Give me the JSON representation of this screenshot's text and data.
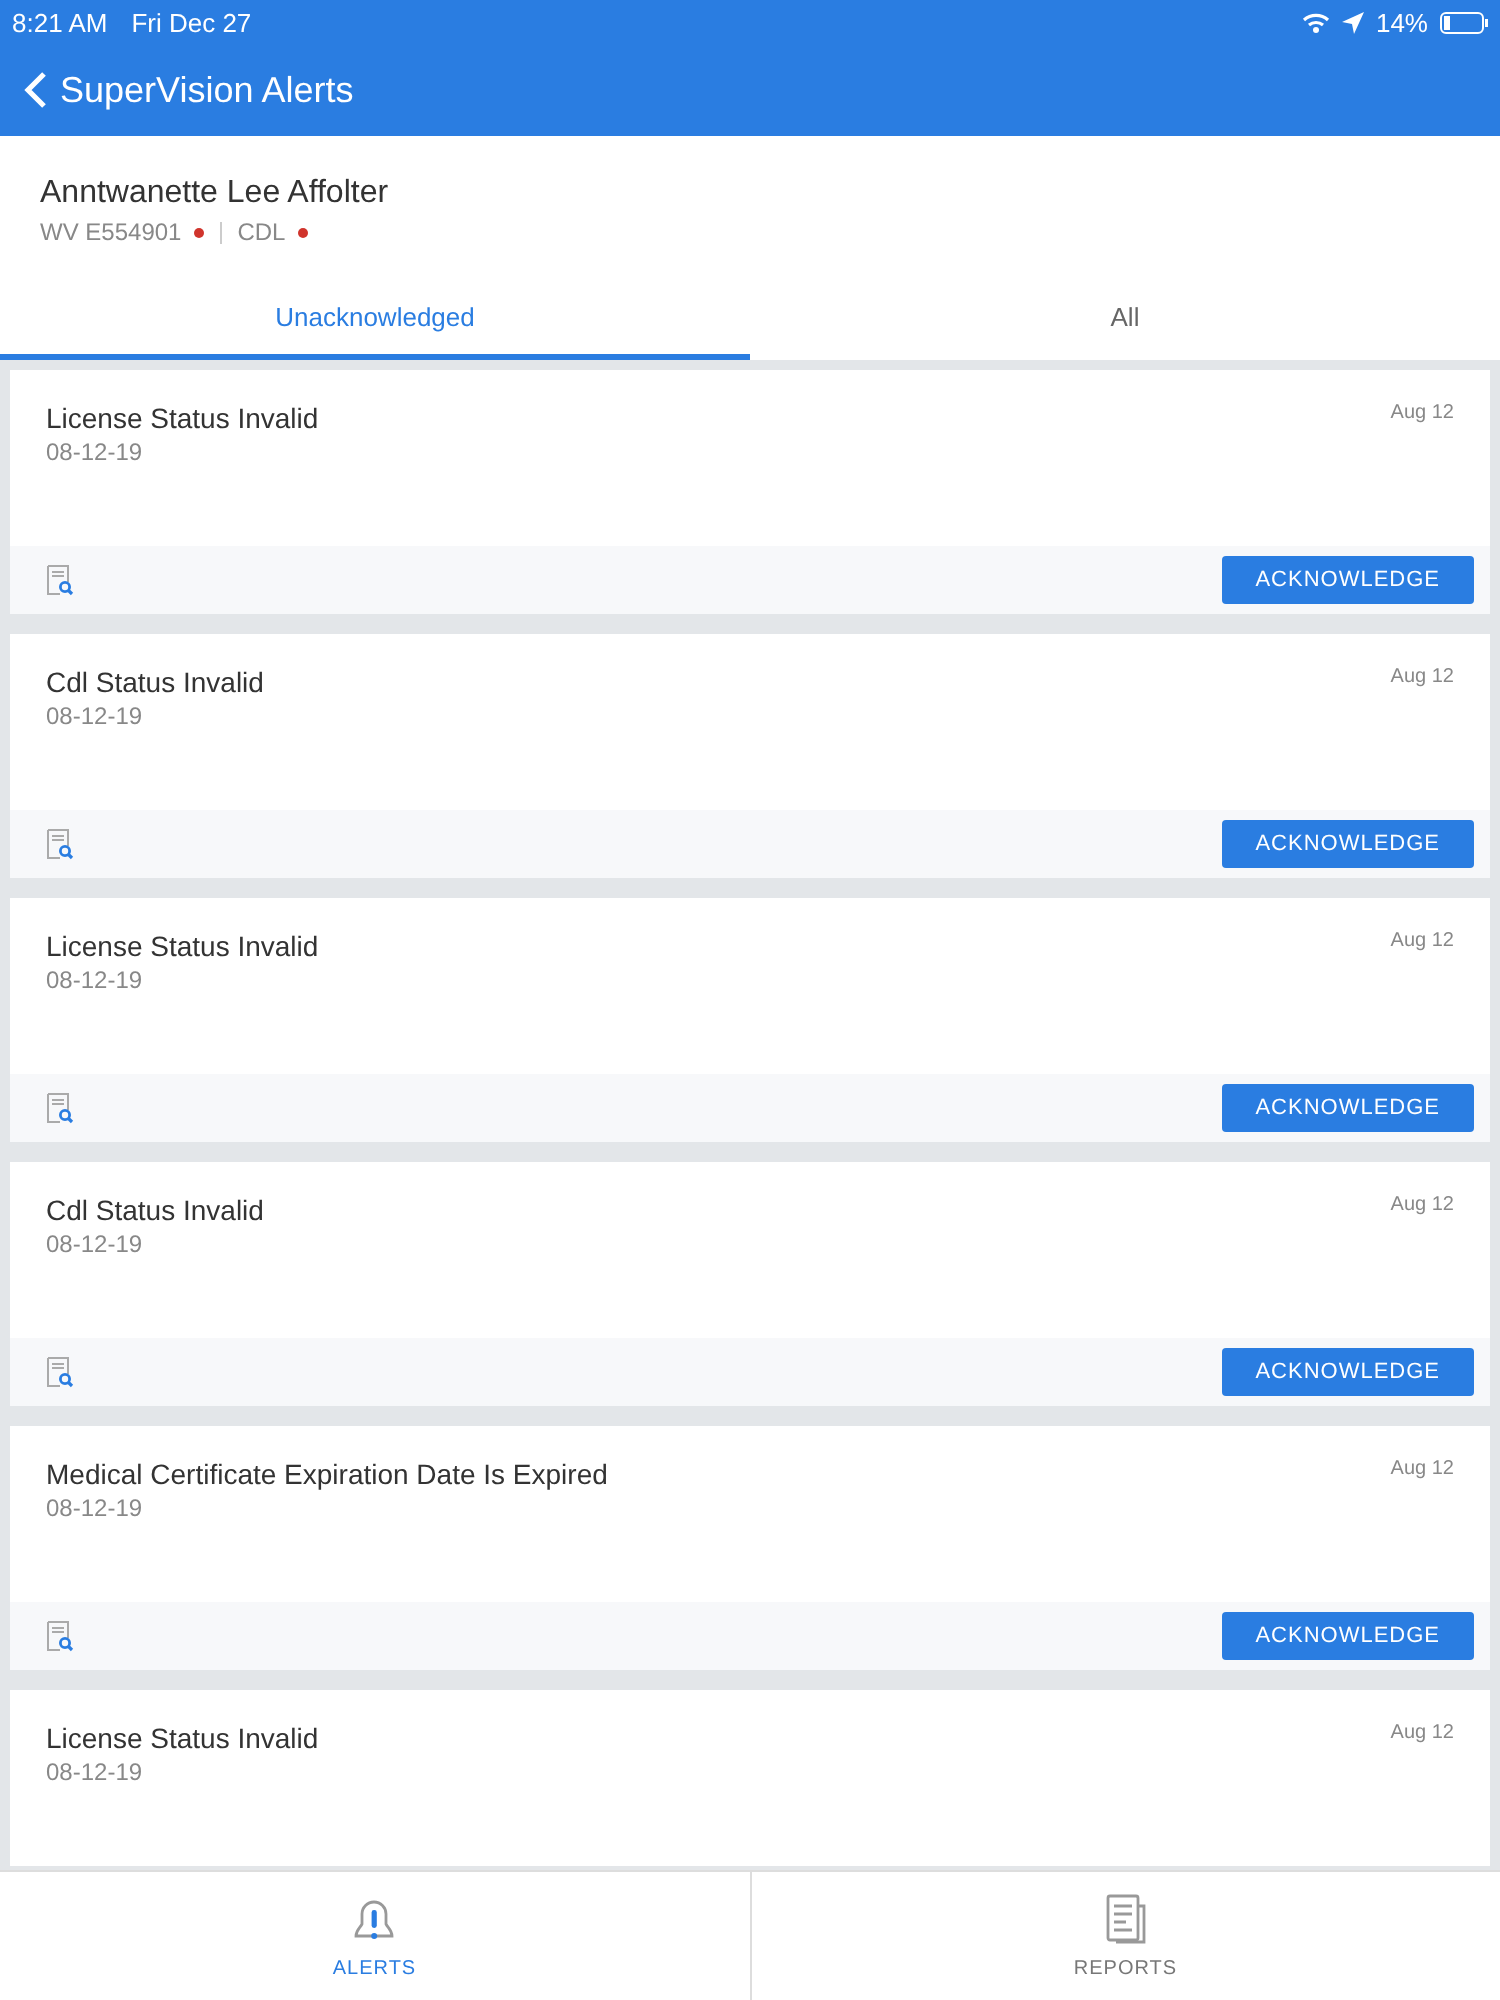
{
  "status_bar": {
    "time": "8:21 AM",
    "date": "Fri Dec 27",
    "battery": "14%"
  },
  "nav": {
    "title": "SuperVision Alerts"
  },
  "driver": {
    "name": "Anntwanette Lee Affolter",
    "badges": [
      {
        "label": "WV E554901",
        "color": "#d0342c"
      },
      {
        "label": "CDL",
        "color": "#d0342c"
      }
    ]
  },
  "tabs": [
    {
      "label": "Unacknowledged",
      "selected": true
    },
    {
      "label": "All",
      "selected": false
    }
  ],
  "alerts": [
    {
      "title": "License Status Invalid",
      "date": "08-12-19",
      "time": "Aug 12",
      "button": "ACKNOWLEDGE"
    },
    {
      "title": "Cdl Status Invalid",
      "date": "08-12-19",
      "time": "Aug 12",
      "button": "ACKNOWLEDGE"
    },
    {
      "title": "License Status Invalid",
      "date": "08-12-19",
      "time": "Aug 12",
      "button": "ACKNOWLEDGE"
    },
    {
      "title": "Cdl Status Invalid",
      "date": "08-12-19",
      "time": "Aug 12",
      "button": "ACKNOWLEDGE"
    },
    {
      "title": "Medical Certificate Expiration Date Is Expired",
      "date": "08-12-19",
      "time": "Aug 12",
      "button": "ACKNOWLEDGE"
    },
    {
      "title": "License Status Invalid",
      "date": "08-12-19",
      "time": "Aug 12"
    }
  ],
  "bottom_tabs": [
    {
      "kind": "alerts",
      "label": "ALERTS",
      "selected": true
    },
    {
      "kind": "reports",
      "label": "REPORTS",
      "selected": false
    }
  ]
}
